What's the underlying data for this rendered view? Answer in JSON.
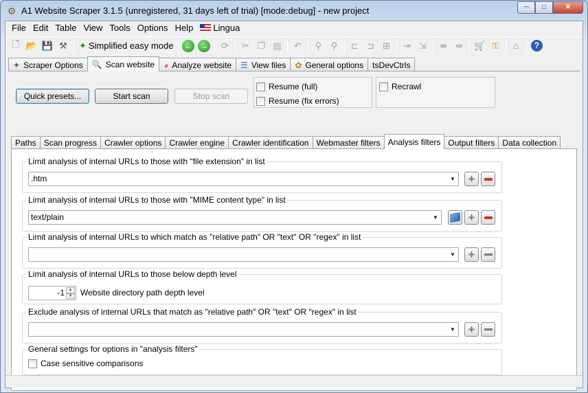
{
  "window": {
    "title": "A1 Website Scraper 3.1.5 (unregistered, 31 days left of trial) [mode:debug] - new project",
    "minimize_glyph": "─",
    "maximize_glyph": "□",
    "close_glyph": "✕"
  },
  "menu": {
    "items": [
      "File",
      "Edit",
      "Table",
      "View",
      "Tools",
      "Options",
      "Help"
    ],
    "lingua_label": "Lingua"
  },
  "toolbar": {
    "simplified_mode_label": "Simplified easy mode",
    "icons": {
      "new": "new-document-icon",
      "open": "open-folder-icon",
      "save": "save-icon",
      "tools": "tools-icon",
      "mode": "simplified-mode-icon",
      "back": "back-arrow-icon",
      "forward": "forward-arrow-icon"
    }
  },
  "main_tabs": [
    {
      "label": "Scraper Options",
      "icon": "scraper-options-icon"
    },
    {
      "label": "Scan website",
      "icon": "magnifier-icon"
    },
    {
      "label": "Analyze website",
      "icon": "chart-pie-icon"
    },
    {
      "label": "View files",
      "icon": "list-icon"
    },
    {
      "label": "General options",
      "icon": "general-options-icon"
    },
    {
      "label": "tsDevCtrls",
      "icon": ""
    }
  ],
  "scan": {
    "quick_presets": "Quick presets...",
    "start_scan": "Start scan",
    "stop_scan": "Stop scan",
    "resume_full": "Resume (full)",
    "resume_fix_errors": "Resume (fix errors)",
    "recrawl": "Recrawl"
  },
  "sub_tabs": [
    "Paths",
    "Scan progress",
    "Crawler options",
    "Crawler engine",
    "Crawler identification",
    "Webmaster filters",
    "Analysis filters",
    "Output filters",
    "Data collection"
  ],
  "analysis_filters": {
    "file_extension": {
      "legend": "Limit analysis of internal URLs to those with \"file extension\" in list",
      "value": ".htm"
    },
    "mime_type": {
      "legend": "Limit analysis of internal URLs to those with \"MIME content type\" in list",
      "value": "text/plain"
    },
    "relative_path": {
      "legend": "Limit analysis of internal URLs to which match as \"relative path\" OR \"text\" OR \"regex\" in list",
      "value": ""
    },
    "depth": {
      "legend": "Limit analysis of internal URLs to those below depth level",
      "value": "-1",
      "label": "Website directory path depth level"
    },
    "exclude": {
      "legend": "Exclude analysis of internal URLs that match as \"relative path\" OR \"text\" OR \"regex\" in list",
      "value": ""
    },
    "general": {
      "legend": "General settings for options in \"analysis filters\"",
      "case_sensitive": "Case sensitive comparisons"
    }
  }
}
